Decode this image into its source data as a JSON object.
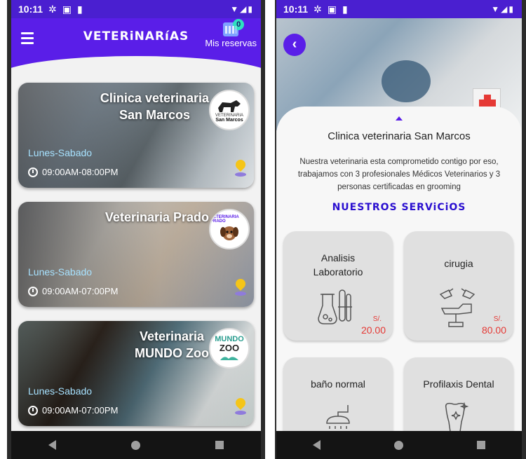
{
  "left": {
    "status": {
      "time": "10:11"
    },
    "header": {
      "title": "VETERiNARíAS",
      "reservas_label": "Mis reservas",
      "reservas_count": "0"
    },
    "cards": [
      {
        "title_line1": "Clinica veterinaria",
        "title_line2": "San Marcos",
        "logo_text1": "VETERINARIA",
        "logo_text2": "San Marcos",
        "days": "Lunes-Sabado",
        "hours": "09:00AM-08:00PM"
      },
      {
        "title_line1": "Veterinaria Prado",
        "title_line2": "",
        "logo_text1": "VETERINARIA PRADO",
        "logo_text2": "",
        "days": "Lunes-Sabado",
        "hours": "09:00AM-07:00PM"
      },
      {
        "title_line1": "Veterinaria",
        "title_line2": "MUNDO Zoo",
        "logo_text1": "MUNDO",
        "logo_text2": "ZOO",
        "days": "Lunes-Sabado",
        "hours": "09:00AM-07:00PM"
      }
    ]
  },
  "right": {
    "status": {
      "time": "10:11"
    },
    "detail": {
      "title": "Clinica veterinaria San Marcos",
      "description": "Nuestra veterinaria esta comprometido contigo por eso, trabajamos con 3 profesionales Médicos Veterinarios y 3 personas certificadas en grooming",
      "services_title": "NUESTROS SERViCiOS"
    },
    "services": [
      {
        "name_line1": "Analisis",
        "name_line2": "Laboratorio",
        "currency": "S/.",
        "price": "20.00",
        "icon": "lab-flask-icon"
      },
      {
        "name_line1": "cirugia",
        "name_line2": "",
        "currency": "S/.",
        "price": "80.00",
        "icon": "surgery-table-icon"
      },
      {
        "name_line1": "baño normal",
        "name_line2": "",
        "currency": "",
        "price": "",
        "icon": "shower-icon"
      },
      {
        "name_line1": "Profilaxis Dental",
        "name_line2": "",
        "currency": "",
        "price": "",
        "icon": "tooth-icon"
      }
    ]
  },
  "colors": {
    "primary": "#5a1ee8",
    "accent_text": "#a7e2ff",
    "price": "#e53935",
    "pin": "#f5c518"
  }
}
